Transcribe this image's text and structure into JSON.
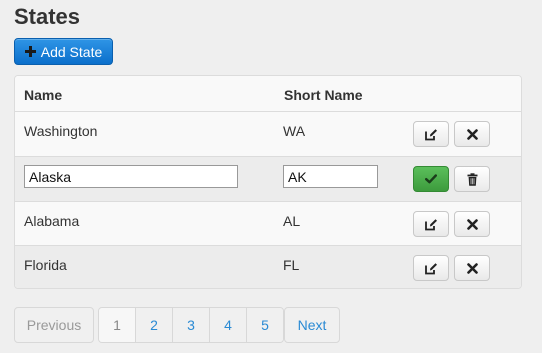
{
  "page": {
    "title": "States"
  },
  "toolbar": {
    "add_label": "Add State"
  },
  "table": {
    "headers": [
      "Name",
      "Short Name"
    ],
    "rows": [
      {
        "name": "Washington",
        "short": "WA",
        "editing": false
      },
      {
        "name": "Alaska",
        "short": "AK",
        "editing": true
      },
      {
        "name": "Alabama",
        "short": "AL",
        "editing": false
      },
      {
        "name": "Florida",
        "short": "FL",
        "editing": false
      }
    ]
  },
  "pagination": {
    "prev_label": "Previous",
    "next_label": "Next",
    "pages": [
      "1",
      "2",
      "3",
      "4",
      "5"
    ],
    "current_page": "1"
  },
  "colors": {
    "primary": "#0b6fcb",
    "success": "#3d9b3d",
    "link": "#2a8ad4"
  },
  "icons": {
    "add": "plus-icon",
    "edit": "edit-icon",
    "delete": "close-icon",
    "save": "check-icon",
    "trash": "trash-icon"
  }
}
